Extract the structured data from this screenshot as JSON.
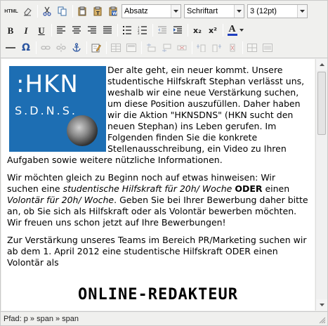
{
  "toolbar": {
    "row1": {
      "html_label": "HTML",
      "format_select": "Absatz",
      "font_select": "Schriftart",
      "size_select": "3 (12pt)"
    },
    "row2": {
      "bold": "B",
      "italic": "I",
      "underline": "U",
      "subscript": "x₂",
      "superscript": "x²",
      "font_color": "A"
    },
    "row3": {
      "special_char": "Ω"
    }
  },
  "content": {
    "logo": {
      "title": ":HKN",
      "subtitle": "S.D.N.S."
    },
    "paragraph1": "Der alte geht, ein neuer kommt. Unsere studentische Hilfskraft Stephan verlässt uns, weshalb wir eine neue Verstärkung suchen, um diese Position auszufüllen. Daher haben wir die Aktion \"HKNSDNS\" (HKN sucht den neuen Stephan) ins Leben gerufen. Im Folgenden finden Sie die konkrete Stellenausschreibung, ein Video zu Ihren Aufgaben sowie weitere nützliche Informationen.",
    "paragraph2": {
      "part1": "Wir möchten gleich zu Beginn noch auf etwas hinweisen: Wir suchen eine ",
      "italic1": "studentische Hilfskraft für 20h/ Woche",
      "part2": " ",
      "bold": "ODER",
      "part3": " einen ",
      "italic2": "Volontär für 20h/ Woche",
      "part4": ". Geben Sie bei Ihrer Bewerbung daher bitte an, ob Sie sich als Hilfskraft oder als Volontär bewerben möchten. Wir freuen uns schon jetzt auf Ihre Bewerbungen!"
    },
    "paragraph3": "Zur Verstärkung unseres Teams im Bereich PR/Marketing suchen wir ab dem 1. April 2012 eine studentische Hilfskraft ODER einen Volontär als",
    "headline": "ONLINE-REDAKTEUR"
  },
  "statusbar": {
    "path": "Pfad: p » span » span"
  },
  "colors": {
    "toolbar_bg": "#f0f0ee",
    "logo_bg": "#1d6eb3",
    "font_color_underline": "#1f3fbf"
  }
}
